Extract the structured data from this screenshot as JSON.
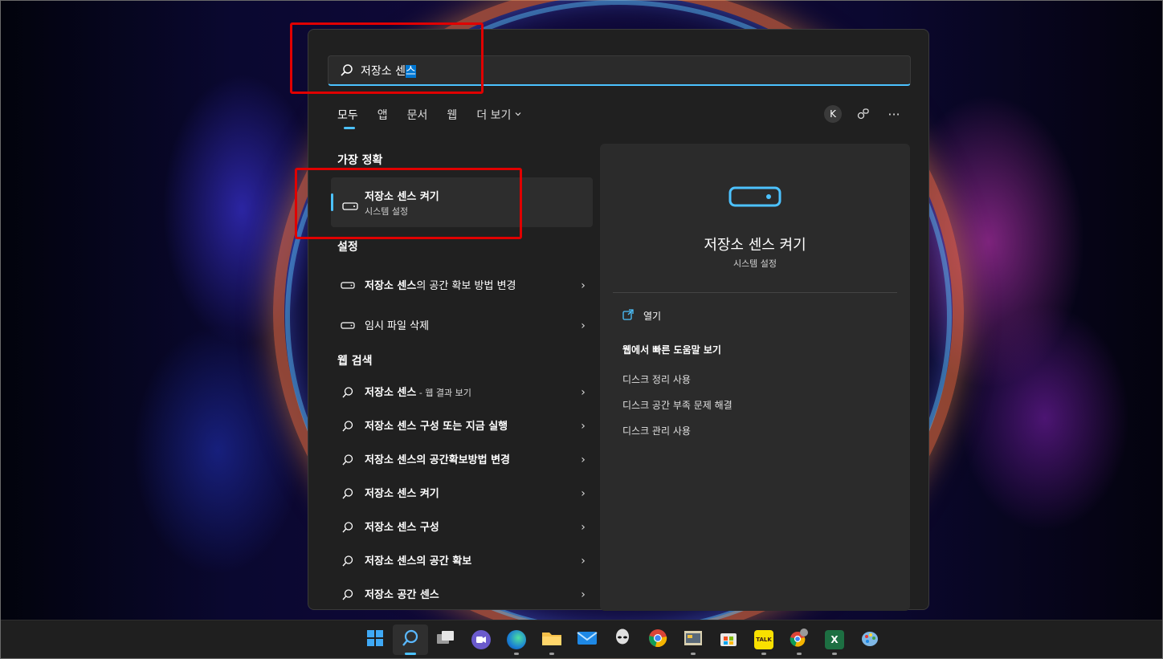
{
  "search": {
    "query_main": "저장소 센",
    "query_selected": "스"
  },
  "tabs": [
    {
      "label": "모두",
      "active": true
    },
    {
      "label": "앱"
    },
    {
      "label": "문서"
    },
    {
      "label": "웹"
    },
    {
      "label": "더 보기"
    }
  ],
  "toolbar": {
    "avatar_letter": "K",
    "more": "···"
  },
  "best_match": {
    "section": "가장 정확",
    "title": "저장소 센스 켜기",
    "subtitle": "시스템 설정"
  },
  "settings": {
    "section": "설정",
    "items": [
      {
        "bold": "저장소 센스",
        "rest": "의 공간 확보 방법 변경"
      },
      {
        "bold": "",
        "rest": "임시 파일 삭제"
      }
    ]
  },
  "web": {
    "section": "웹 검색",
    "items": [
      {
        "bold": "저장소 센스",
        "rest": "",
        "small": " - 웹 결과 보기"
      },
      {
        "bold": "저장소 센스 구성 또는 지금 실행",
        "rest": "",
        "small": ""
      },
      {
        "bold": "저장소 센스의 공간확보방법 변경",
        "rest": "",
        "small": ""
      },
      {
        "bold": "저장소 센스 켜기",
        "rest": "",
        "small": ""
      },
      {
        "bold": "저장소 센스 구성",
        "rest": "",
        "small": ""
      },
      {
        "bold": "저장소 센스의 공간 확보",
        "rest": "",
        "small": ""
      },
      {
        "bold": "저장소 공간 센스",
        "rest": "",
        "small": ""
      }
    ]
  },
  "detail": {
    "title": "저장소 센스 켜기",
    "subtitle": "시스템 설정",
    "open_label": "열기",
    "web_help_title": "웹에서 빠른 도움말 보기",
    "links": [
      "디스크 정리 사용",
      "디스크 공간 부족 문제 해결",
      "디스크 관리 사용"
    ]
  },
  "taskbar": {
    "apps": [
      "windows-start",
      "search",
      "task-view",
      "teams-chat",
      "edge",
      "file-explorer",
      "mail",
      "alienware",
      "chrome",
      "photo-viewer",
      "microsoft-store",
      "kakaotalk",
      "chrome-profile",
      "excel",
      "paint"
    ],
    "kakaotalk_label": "TALK",
    "excel_label": "X"
  },
  "colors": {
    "accent": "#4cc2ff",
    "highlight": "#e00000",
    "panel": "#202020"
  }
}
